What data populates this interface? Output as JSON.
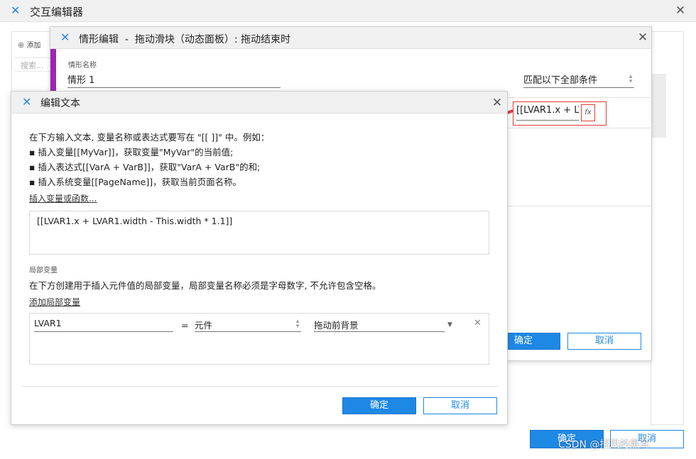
{
  "main_window": {
    "title": "交互编辑器",
    "toolbar_add": "添加",
    "search_placeholder": "搜索...",
    "ok": "确定",
    "cancel": "取消"
  },
  "case_editor": {
    "title": "情形编辑  -  拖动滑块（动态面板）: 拖动结束时",
    "name_label": "情形名称",
    "name_value": "情形 1",
    "match_select": "匹配以下全部条件",
    "condition_text": "[[LVAR1.x + LV",
    "fx_label": "fx",
    "ok": "确定",
    "cancel": "取消"
  },
  "edit_text": {
    "title": "编辑文本",
    "instruction_lines": [
      "在下方输入文本, 变量名称或表达式要写在 \"[[ ]]\" 中。例如：",
      "▪ 插入变量[[MyVar]]，获取变量\"MyVar\"的当前值;",
      "▪ 插入表达式[[VarA + VarB]]，获取\"VarA + VarB\"的和;",
      "▪ 插入系统变量[[PageName]]，获取当前页面名称。"
    ],
    "insert_link": "插入变量或函数...",
    "expression": "[[LVAR1.x + LVAR1.width - This.width * 1.1]]",
    "local_var_label": "局部变量",
    "local_var_desc": "在下方创建用于插入元件值的局部变量，局部变量名称必须是字母数字, 不允许包含空格。",
    "add_local_link": "添加局部变量",
    "row": {
      "name": "LVAR1",
      "equals": "=",
      "type": "元件",
      "target": "拖动前背景"
    },
    "ok": "确定",
    "cancel": "取消"
  },
  "watermark": "CSDN @招风的黑耳",
  "colors": {
    "accent": "#1e88e5",
    "highlight_red": "#e53935",
    "purple_bar": "#9c27b0"
  }
}
